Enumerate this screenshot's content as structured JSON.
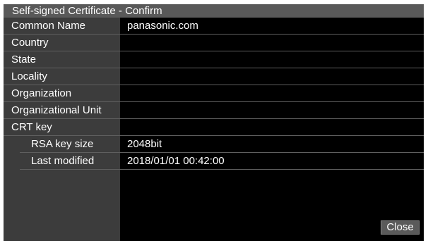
{
  "dialog": {
    "title": "Self-signed Certificate - Confirm",
    "close_label": "Close"
  },
  "certificate": {
    "common_name": {
      "label": "Common Name",
      "value": "panasonic.com"
    },
    "country": {
      "label": "Country",
      "value": ""
    },
    "state": {
      "label": "State",
      "value": ""
    },
    "locality": {
      "label": "Locality",
      "value": ""
    },
    "organization": {
      "label": "Organization",
      "value": ""
    },
    "organizational_unit": {
      "label": "Organizational Unit",
      "value": ""
    },
    "crt_key": {
      "label": "CRT key",
      "value": ""
    },
    "rsa_key_size": {
      "label": "RSA key size",
      "value": "2048bit"
    },
    "last_modified": {
      "label": "Last modified",
      "value": "2018/01/01 00:42:00"
    }
  }
}
